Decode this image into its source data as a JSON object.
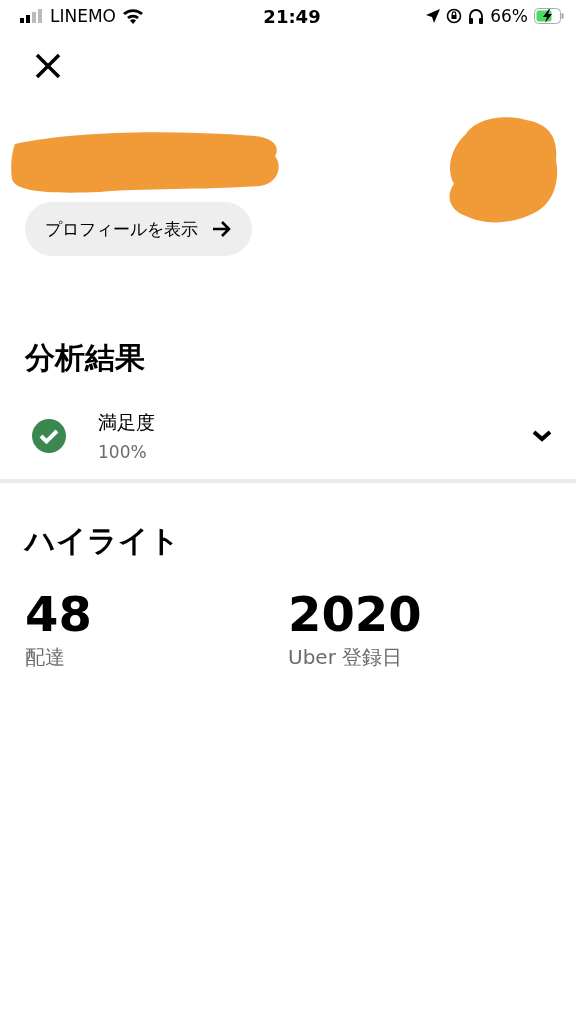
{
  "status_bar": {
    "carrier": "LINEMO",
    "time": "21:49",
    "battery": "66%"
  },
  "profile": {
    "button": "プロフィールを表示"
  },
  "analysis": {
    "title": "分析結果",
    "items": [
      {
        "label": "満足度",
        "value": "100%",
        "expanded": false
      }
    ]
  },
  "highlights": {
    "title": "ハイライト",
    "stats": [
      {
        "value": "48",
        "label": "配達"
      },
      {
        "value": "2020",
        "label": "Uber 登録日"
      }
    ]
  }
}
